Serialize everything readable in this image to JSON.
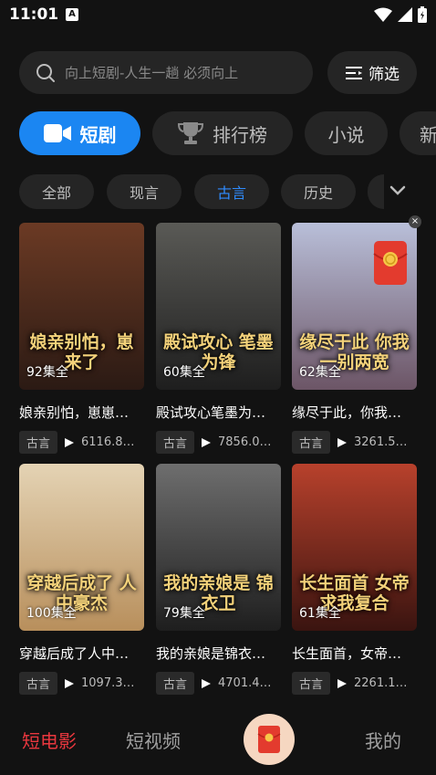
{
  "status": {
    "time": "11:01",
    "a_badge": "A"
  },
  "search": {
    "placeholder": "向上短剧-人生一趟 必须向上"
  },
  "filter": {
    "label": "筛选"
  },
  "categories": [
    {
      "label": "短剧",
      "icon": "video-camera-icon",
      "active": true
    },
    {
      "label": "排行榜",
      "icon": "trophy-icon",
      "active": false
    },
    {
      "label": "小说",
      "active": false
    },
    {
      "label": "新",
      "active": false
    }
  ],
  "genres": [
    {
      "label": "全部",
      "active": false
    },
    {
      "label": "现言",
      "active": false
    },
    {
      "label": "古言",
      "active": true
    },
    {
      "label": "历史",
      "active": false
    }
  ],
  "dramas": [
    {
      "title": "娘亲别怕，崽崽…",
      "poster_title": "娘亲别怕，崽来了",
      "episodes": "92集全",
      "tag": "古言",
      "views": "6116.8…",
      "colors": [
        "#6b3a24",
        "#2b1a14"
      ]
    },
    {
      "title": "殿试攻心笔墨为…",
      "poster_title": "殿试攻心 笔墨为锋",
      "episodes": "60集全",
      "tag": "古言",
      "views": "7856.0…",
      "colors": [
        "#5a5a56",
        "#1e1e1e"
      ]
    },
    {
      "title": "缘尽于此，你我…",
      "poster_title": "缘尽于此 你我一别两宽",
      "episodes": "62集全",
      "tag": "古言",
      "views": "3261.5…",
      "colors": [
        "#b9bfd9",
        "#6c5566"
      ]
    },
    {
      "title": "穿越后成了人中…",
      "poster_title": "穿越后成了 人中豪杰",
      "episodes": "100集全",
      "tag": "古言",
      "views": "1097.3…",
      "colors": [
        "#e4d3b4",
        "#b88f5c"
      ]
    },
    {
      "title": "我的亲娘是锦衣…",
      "poster_title": "我的亲娘是 锦衣卫",
      "episodes": "79集全",
      "tag": "古言",
      "views": "4701.4…",
      "colors": [
        "#6e6e6e",
        "#1e1e1e"
      ]
    },
    {
      "title": "长生面首，女帝…",
      "poster_title": "长生面首 女帝求我复合",
      "episodes": "61集全",
      "tag": "古言",
      "views": "2261.1…",
      "colors": [
        "#b8412c",
        "#3a1410"
      ]
    }
  ],
  "bottom_nav": {
    "items": [
      {
        "label": "短电影",
        "active": true
      },
      {
        "label": "短视频",
        "active": false
      },
      {
        "label": "我的",
        "active": false
      }
    ],
    "center_icon": "red-envelope-icon"
  },
  "theme": {
    "accent": "#1b86f2",
    "nav_active": "#e8373e",
    "gold_text": "#f4d27a"
  }
}
